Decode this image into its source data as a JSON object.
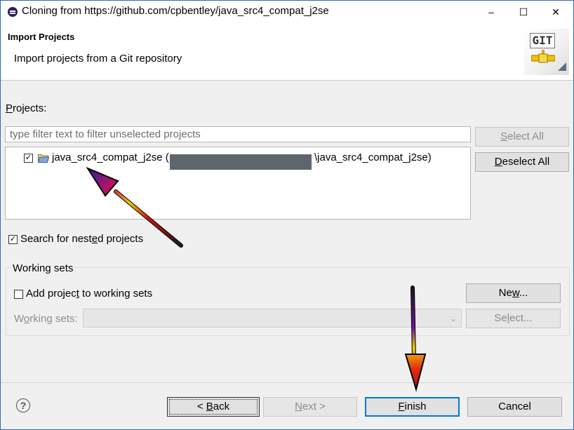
{
  "window": {
    "title": "Cloning from https://github.com/cpbentley/java_src4_compat_j2se",
    "controls": {
      "minimize": "–",
      "maximize": "☐",
      "close": "✕"
    }
  },
  "header": {
    "title": "Import Projects",
    "subtitle": "Import projects from a Git repository",
    "logo_text": "GIT"
  },
  "projects": {
    "label_prefix": "P",
    "label_rest": "rojects:",
    "filter_placeholder": "type filter text to filter unselected projects",
    "items": [
      {
        "name": "java_src4_compat_j2se (",
        "path_suffix": "\\java_src4_compat_j2se)",
        "checked": true
      }
    ],
    "select_all": {
      "u": "S",
      "rest": "elect All"
    },
    "deselect_all": {
      "u": "D",
      "rest": "eselect All"
    },
    "nested": {
      "pre": "Search for nest",
      "u": "e",
      "post": "d projects"
    }
  },
  "working_sets": {
    "title": "Working sets",
    "add": {
      "pre": "Add projec",
      "u": "t",
      "post": " to working sets"
    },
    "new": {
      "pre": "Ne",
      "u": "w",
      "post": "..."
    },
    "sets_label": {
      "pre": "W",
      "u": "o",
      "post": "rking sets:"
    },
    "select": {
      "pre": "Se",
      "u": "l",
      "post": "ect..."
    }
  },
  "footer": {
    "help": "?",
    "back": {
      "pre": "< ",
      "u": "B",
      "post": "ack"
    },
    "next": {
      "u": "N",
      "post": "ext >"
    },
    "finish": {
      "u": "F",
      "post": "inish"
    },
    "cancel": "Cancel"
  },
  "colors": {
    "accent": "#0078d7",
    "redaction": "#5f656d"
  }
}
